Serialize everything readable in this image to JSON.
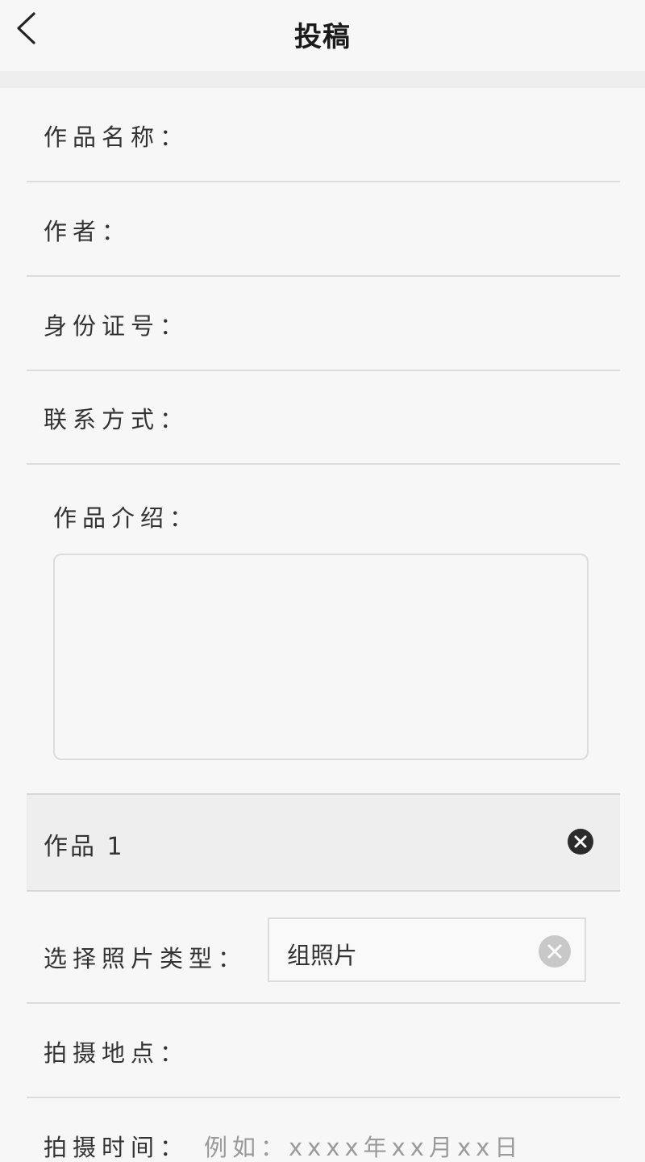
{
  "header": {
    "title": "投稿",
    "back_icon": "chevron-left-icon"
  },
  "form": {
    "work_name_label": "作品名称：",
    "author_label": "作者：",
    "id_number_label": "身份证号：",
    "contact_label": "联系方式：",
    "intro_label": "作品介绍："
  },
  "work": {
    "title": "作品 1",
    "remove_icon": "close-circle-icon",
    "photo_type_label": "选择照片类型：",
    "photo_type_value": "组照片",
    "clear_icon": "clear-circle-icon",
    "location_label": "拍摄地点：",
    "time_label": "拍摄时间：",
    "time_placeholder": "例如：xxxx年xx月xx日"
  },
  "colors": {
    "background": "#f7f7f7",
    "divider": "#dcdcdc",
    "section_bg": "#eeeeee",
    "text": "#333333",
    "placeholder": "#9a9a9a"
  }
}
